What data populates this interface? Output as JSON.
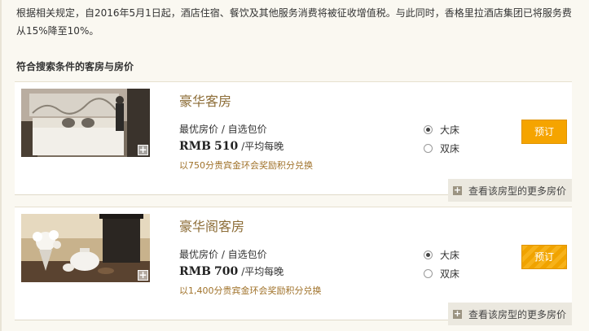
{
  "notice": {
    "text": "根据相关规定，自2016年5月1日起，酒店住宿、餐饮及其他服务消费将被征收增值税。与此同时，香格里拉酒店集团已将服务费从15%降至10%。"
  },
  "section_title": "符合搜索条件的客房与房价",
  "rooms": [
    {
      "name": "豪华客房",
      "rate_label": "最优房价 / 自选包价",
      "currency": "RMB",
      "amount": "510",
      "per_night": "/平均每晚",
      "points": "以750分贵宾金环会奖励积分兑换",
      "bed_options": [
        {
          "label": "大床",
          "selected": true
        },
        {
          "label": "双床",
          "selected": false
        }
      ],
      "book_label": "预订",
      "more_rates": "查看该房型的更多房价"
    },
    {
      "name": "豪华阁客房",
      "rate_label": "最优房价 / 自选包价",
      "currency": "RMB",
      "amount": "700",
      "per_night": "/平均每晚",
      "points": "以1,400分贵宾金环会奖励积分兑换",
      "bed_options": [
        {
          "label": "大床",
          "selected": true
        },
        {
          "label": "双床",
          "selected": false
        }
      ],
      "book_label": "预订",
      "more_rates": "查看该房型的更多房价"
    }
  ],
  "colors": {
    "accent": "#f5a400",
    "room_name": "#8c6c36",
    "points": "#a0722a",
    "background": "#faf8f1"
  },
  "icons": [
    "thumb-expand-icon",
    "radio-icon",
    "plus-box-icon"
  ]
}
